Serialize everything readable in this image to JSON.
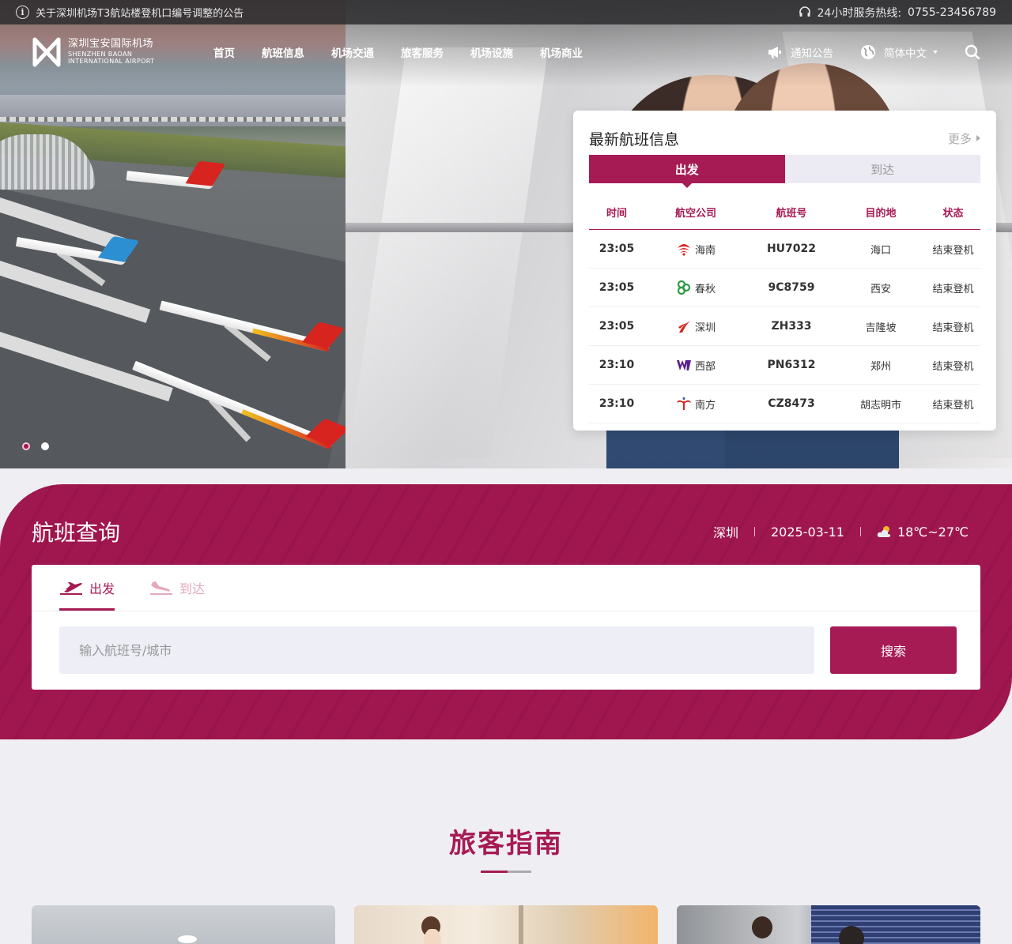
{
  "topbar": {
    "notice": "关于深圳机场T3航站楼登机口编号调整的公告",
    "hotline_label": "24小时服务热线:",
    "hotline_number": "0755-23456789"
  },
  "logo": {
    "name_cn": "深圳宝安国际机场",
    "name_en_1": "SHENZHEN BAOAN",
    "name_en_2": "INTERNATIONAL AIRPORT"
  },
  "nav": {
    "items": [
      "首页",
      "航班信息",
      "机场交通",
      "旅客服务",
      "机场设施",
      "机场商业"
    ],
    "notice_label": "通知公告",
    "language_label": "简体中文"
  },
  "slider": {
    "count": 2,
    "active": 0
  },
  "flight_panel": {
    "title": "最新航班信息",
    "more": "更多",
    "tabs": [
      "出发",
      "到达"
    ],
    "columns": [
      "时间",
      "航空公司",
      "航班号",
      "目的地",
      "状态"
    ],
    "rows": [
      {
        "time": "23:05",
        "airline": "海南",
        "airline_icon": "hainan-airlines-icon",
        "flight": "HU7022",
        "dest": "海口",
        "status": "结束登机"
      },
      {
        "time": "23:05",
        "airline": "春秋",
        "airline_icon": "spring-airlines-icon",
        "flight": "9C8759",
        "dest": "西安",
        "status": "结束登机"
      },
      {
        "time": "23:05",
        "airline": "深圳",
        "airline_icon": "shenzhen-airlines-icon",
        "flight": "ZH333",
        "dest": "吉隆坡",
        "status": "结束登机"
      },
      {
        "time": "23:10",
        "airline": "西部",
        "airline_icon": "west-air-icon",
        "flight": "PN6312",
        "dest": "郑州",
        "status": "结束登机"
      },
      {
        "time": "23:10",
        "airline": "南方",
        "airline_icon": "china-southern-icon",
        "flight": "CZ8473",
        "dest": "胡志明市",
        "status": "结束登机"
      }
    ]
  },
  "flight_search": {
    "title": "航班查询",
    "city": "深圳",
    "date": "2025-03-11",
    "weather": "18℃~27℃",
    "tabs": [
      "出发",
      "到达"
    ],
    "placeholder": "输入航班号/城市",
    "button": "搜索"
  },
  "guide": {
    "title": "旅客指南"
  },
  "colors": {
    "brand": "#a61b54",
    "brand_dark": "#98144b",
    "tab_inactive_bg": "#eceaf3"
  }
}
